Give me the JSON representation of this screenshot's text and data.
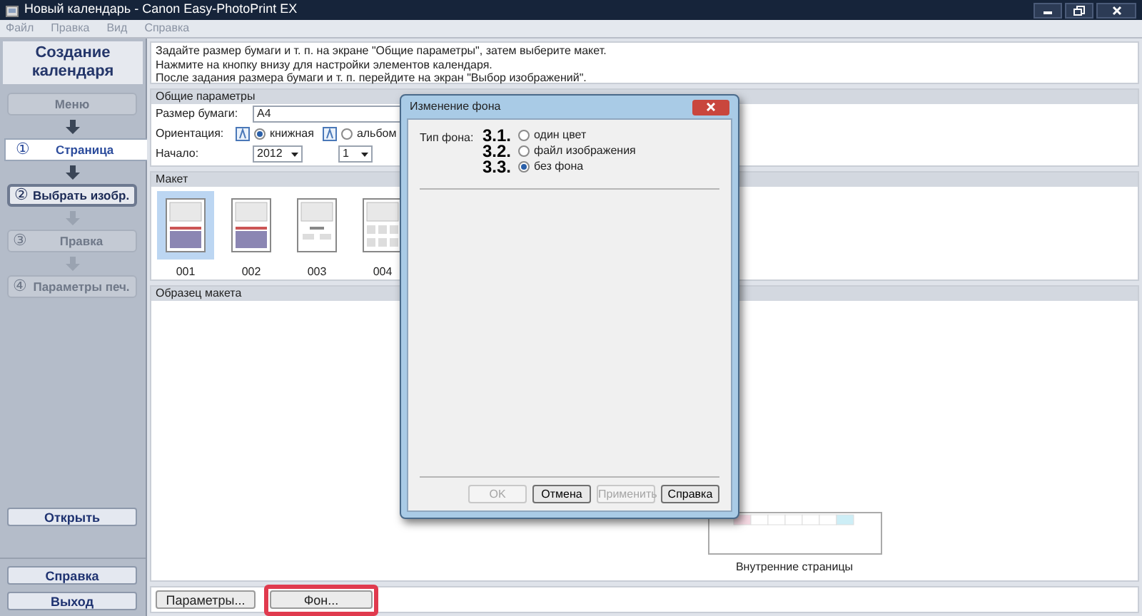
{
  "window": {
    "title": "Новый календарь - Canon Easy-PhotoPrint EX"
  },
  "menu": [
    "Файл",
    "Правка",
    "Вид",
    "Справка"
  ],
  "sidebar": {
    "title": "Создание календаря",
    "steps": [
      {
        "label": "Меню",
        "selected": false,
        "disabled": true
      },
      {
        "number": "①",
        "label": "Страница",
        "selected": true,
        "disabled": false
      },
      {
        "number": "②",
        "label": "Выбрать изобр.",
        "selected": false,
        "disabled": false
      },
      {
        "number": "③",
        "label": "Правка",
        "selected": false,
        "disabled": true
      },
      {
        "number": "④",
        "label": "Параметры печ.",
        "selected": false,
        "disabled": true
      }
    ],
    "open_button": "Открыть",
    "help_button": "Справка",
    "exit_button": "Выход"
  },
  "instructions": [
    "Задайте размер бумаги и т. п. на экране \"Общие параметры\", затем выберите макет.",
    "Нажмите на кнопку внизу для настройки элементов календаря.",
    "После задания размера бумаги и т. п. перейдите на экран \"Выбор изображений\"."
  ],
  "general": {
    "title": "Общие параметры",
    "paper_label": "Размер бумаги:",
    "paper_value": "A4",
    "orientation_label": "Ориентация:",
    "orientations": [
      {
        "label": "книжная",
        "selected": true
      },
      {
        "label": "альбом",
        "selected": false
      }
    ],
    "start_label": "Начало:",
    "year": "2012",
    "month": "1"
  },
  "layout": {
    "title": "Макет",
    "items": [
      {
        "label": "001",
        "kind": "grid",
        "selected": true
      },
      {
        "label": "002",
        "kind": "grid",
        "selected": false
      },
      {
        "label": "003",
        "kind": "minimal",
        "selected": false
      },
      {
        "label": "004",
        "kind": "multi",
        "selected": false
      }
    ]
  },
  "sample": {
    "title": "Образец макета",
    "caption": "Внутренние страницы"
  },
  "bottom_buttons": [
    {
      "label": "Параметры...",
      "highlighted": false
    },
    {
      "label": "Фон...",
      "highlighted": true
    }
  ],
  "dialog": {
    "title": "Изменение фона",
    "type_label": "Тип фона:",
    "options": [
      {
        "marker": "3.1.",
        "label": "один цвет",
        "selected": false
      },
      {
        "marker": "3.2.",
        "label": "файл изображения",
        "selected": false
      },
      {
        "marker": "3.3.",
        "label": "без фона",
        "selected": true
      }
    ],
    "buttons": [
      {
        "label": "OK",
        "disabled": true
      },
      {
        "label": "Отмена",
        "disabled": false
      },
      {
        "label": "Применить",
        "disabled": true
      },
      {
        "label": "Справка",
        "disabled": false
      }
    ]
  }
}
